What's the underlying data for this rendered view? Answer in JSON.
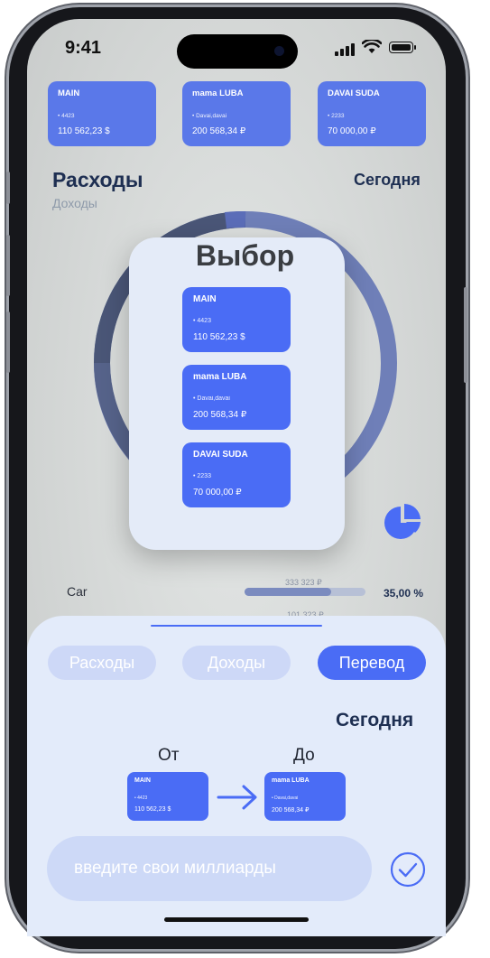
{
  "status": {
    "time": "9:41"
  },
  "accounts": [
    {
      "name": "MAIN",
      "number": "• 4423",
      "amount": "110 562,23 $"
    },
    {
      "name": "mama LUBA",
      "number": "• Davai,davai",
      "amount": "200 568,34 ₽"
    },
    {
      "name": "DAVAI SUDA",
      "number": "• 2233",
      "amount": "70 000,00 ₽"
    }
  ],
  "overview": {
    "title": "Расходы",
    "subtitle": "Доходы",
    "period": "Сегодня",
    "categories": [
      {
        "label": "Car",
        "value": "333 323 ₽",
        "percent": "35,00 %",
        "fill": 0.72
      }
    ],
    "second_value": "101 323 ₽"
  },
  "picker": {
    "title": "Выбор"
  },
  "sheet": {
    "tabs": [
      "Расходы",
      "Доходы",
      "Перевод"
    ],
    "active_tab": "Перевод",
    "period": "Сегодня",
    "from_label": "От",
    "to_label": "До",
    "from_account": 0,
    "to_account": 1,
    "amount_placeholder": "введите свои миллиарды"
  },
  "icons": [
    "signal-icon",
    "wifi-icon",
    "battery-icon",
    "pie-chart-icon",
    "arrow-right-icon",
    "check-circle-icon"
  ],
  "colors": {
    "accent": "#4a6cf5",
    "title": "#1e2f52",
    "sheet": "#e3ebfa",
    "tab_inactive": "#cdd8f7"
  }
}
